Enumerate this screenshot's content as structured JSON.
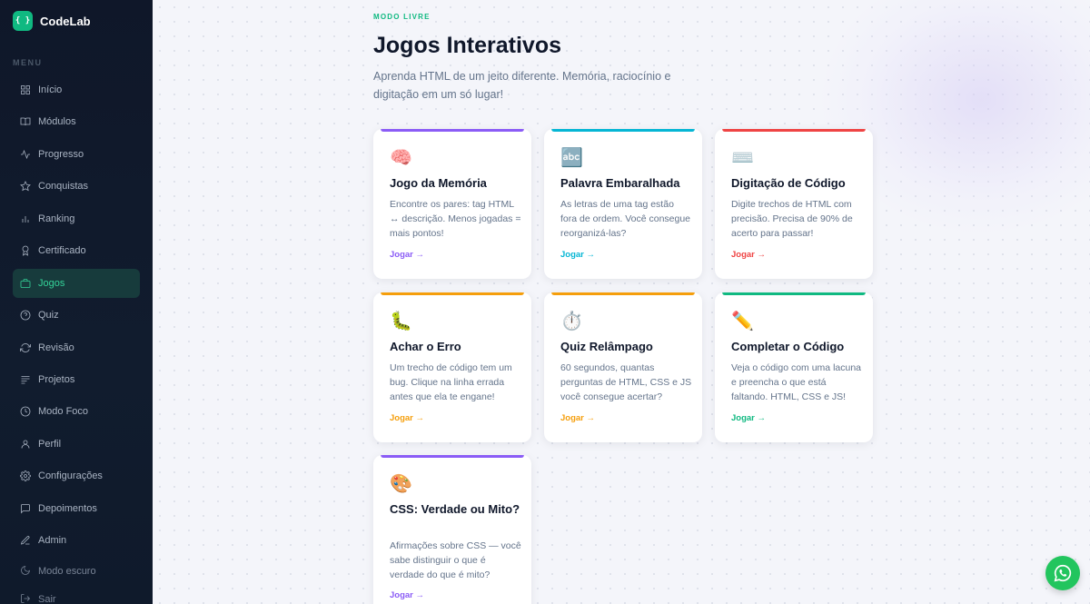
{
  "brand": {
    "logo": "{ }",
    "name": "CodeLab"
  },
  "sidebar": {
    "heading": "MENU",
    "items": [
      {
        "label": "Início",
        "icon": "grid-icon"
      },
      {
        "label": "Módulos",
        "icon": "book-icon"
      },
      {
        "label": "Progresso",
        "icon": "activity-icon"
      },
      {
        "label": "Conquistas",
        "icon": "star-icon"
      },
      {
        "label": "Ranking",
        "icon": "bar-chart-icon"
      },
      {
        "label": "Certificado",
        "icon": "award-icon"
      },
      {
        "label": "Jogos",
        "icon": "gamepad-icon",
        "active": true
      },
      {
        "label": "Quiz",
        "icon": "help-circle-icon"
      },
      {
        "label": "Revisão",
        "icon": "refresh-icon"
      },
      {
        "label": "Projetos",
        "icon": "layers-icon"
      },
      {
        "label": "Modo Foco",
        "icon": "clock-icon"
      },
      {
        "label": "Perfil",
        "icon": "user-icon"
      },
      {
        "label": "Configurações",
        "icon": "settings-icon"
      },
      {
        "label": "Depoimentos",
        "icon": "message-icon"
      },
      {
        "label": "Admin",
        "icon": "edit-icon"
      }
    ],
    "dark_mode": "Modo escuro",
    "logout": "Sair"
  },
  "header": {
    "eyebrow": "MODO LIVRE",
    "title": "Jogos Interativos",
    "subtitle": "Aprenda HTML de um jeito diferente. Memória, raciocínio e digitação em um só lugar!"
  },
  "games": [
    {
      "emoji": "🧠",
      "title": "Jogo da Memória",
      "desc": "Encontre os pares: tag HTML ↔ descrição. Menos jogadas = mais pontos!",
      "cta": "Jogar →",
      "color": "#8b5cf6"
    },
    {
      "emoji": "🔤",
      "title": "Palavra Embaralhada",
      "desc": "As letras de uma tag estão fora de ordem. Você consegue reorganizá-las?",
      "cta": "Jogar →",
      "color": "#06b6d4"
    },
    {
      "emoji": "⌨️",
      "title": "Digitação de Código",
      "desc": "Digite trechos de HTML com precisão. Precisa de 90% de acerto para passar!",
      "cta": "Jogar →",
      "color": "#ef4444"
    },
    {
      "emoji": "🐛",
      "title": "Achar o Erro",
      "desc": "Um trecho de código tem um bug. Clique na linha errada antes que ela te engane!",
      "cta": "Jogar →",
      "color": "#f59e0b"
    },
    {
      "emoji": "⏱️",
      "title": "Quiz Relâmpago",
      "desc": "60 segundos, quantas perguntas de HTML, CSS e JS você consegue acertar?",
      "cta": "Jogar →",
      "color": "#f59e0b"
    },
    {
      "emoji": "✏️",
      "title": "Completar o Código",
      "desc": "Veja o código com uma lacuna e preencha o que está faltando. HTML, CSS e JS!",
      "cta": "Jogar →",
      "color": "#10b981"
    },
    {
      "emoji": "🎨",
      "title": "CSS: Verdade ou Mito?",
      "desc": "Afirmações sobre CSS — você sabe distinguir o que é verdade do que é mito?",
      "cta": "Jogar →",
      "color": "#8b5cf6"
    }
  ],
  "colors": {
    "accent": "#10b981",
    "sidebar_bg": "#0f1729",
    "whatsapp": "#22c55e"
  }
}
